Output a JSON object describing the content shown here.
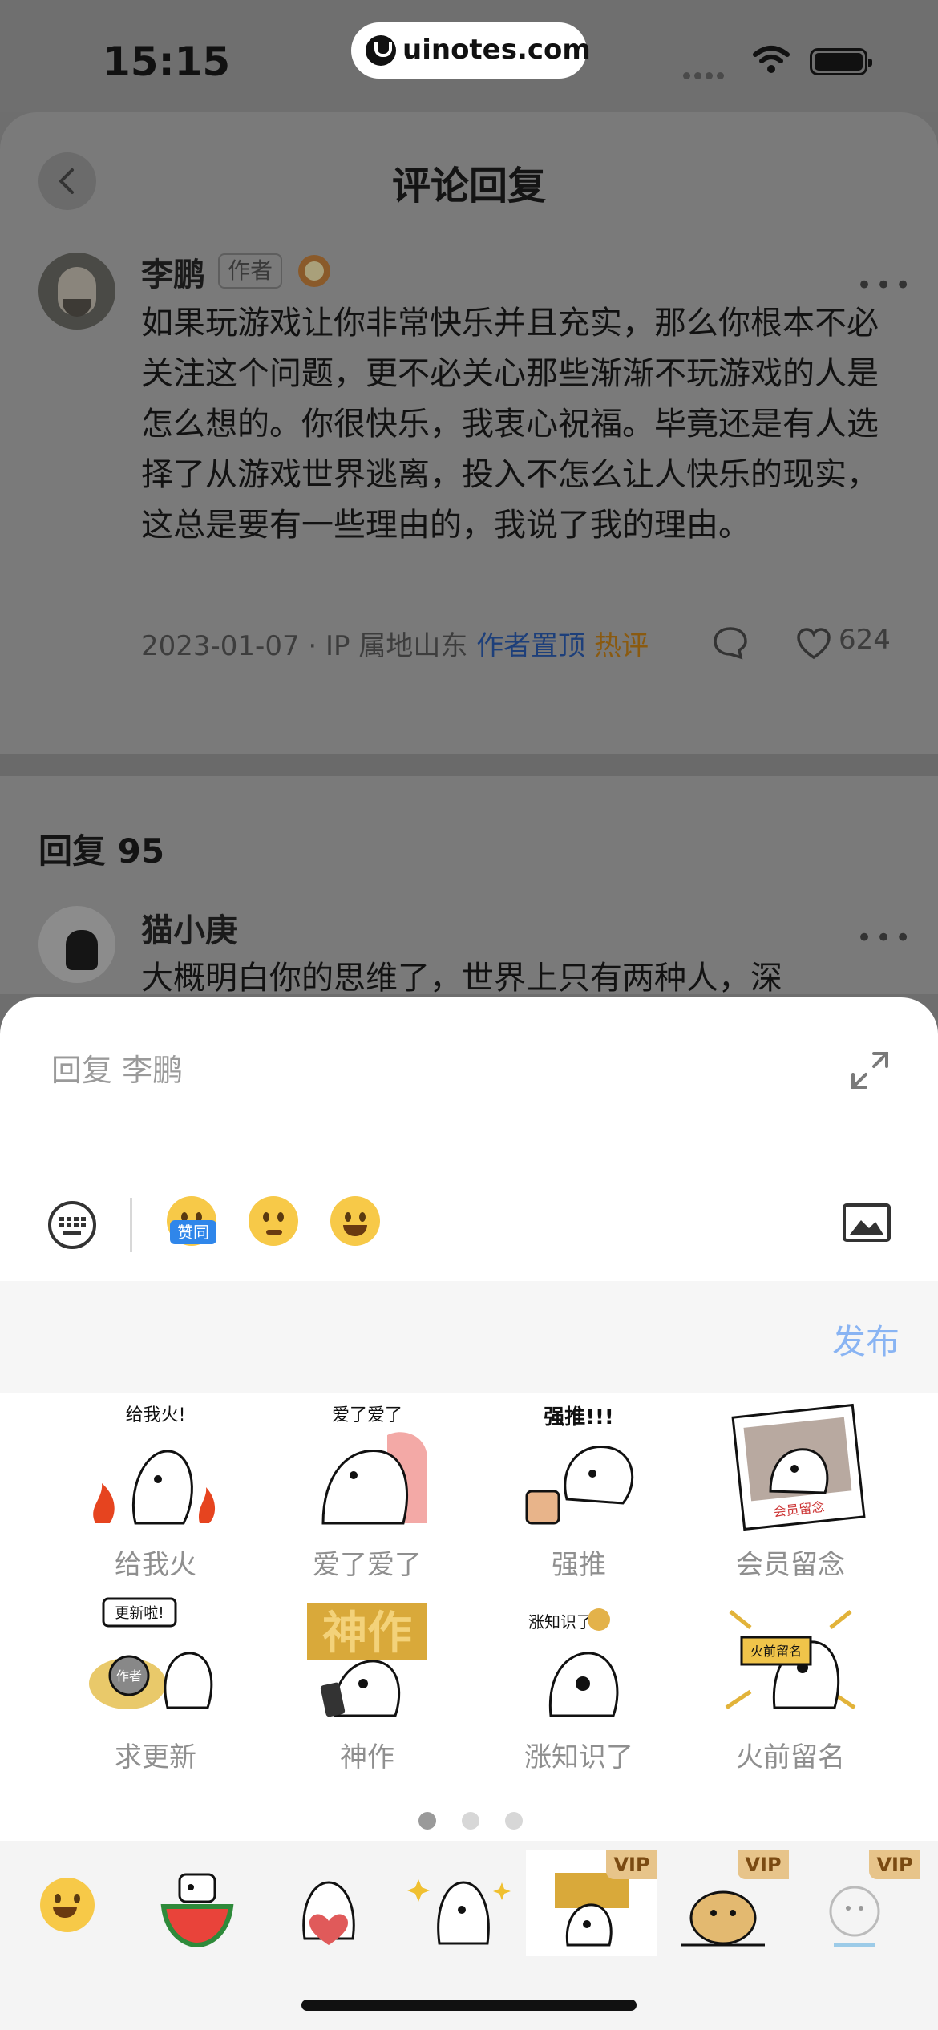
{
  "status_bar": {
    "time": "15:15",
    "url": "uinotes.com"
  },
  "header": {
    "title": "评论回复"
  },
  "main_comment": {
    "author": "李鹏",
    "author_tag": "作者",
    "text": "如果玩游戏让你非常快乐并且充实，那么你根本不必关注这个问题，更不必关心那些渐渐不玩游戏的人是怎么想的。你很快乐，我衷心祝福。毕竟还是有人选择了从游戏世界逃离，投入不怎么让人快乐的现实，这总是要有一些理由的，我说了我的理由。",
    "date": "2023-01-07",
    "location": "IP 属地山东",
    "pinned": "作者置顶",
    "hot": "热评",
    "likes": "624"
  },
  "replies": {
    "heading": "回复 95",
    "first": {
      "author": "猫小庚",
      "text": "大概明白你的思维了，世界上只有两种人，深"
    }
  },
  "reply_panel": {
    "placeholder": "回复 李鹏",
    "zan_tag": "赞同",
    "publish": "发布",
    "stickers": [
      {
        "label": "给我火",
        "caption": "给我火!"
      },
      {
        "label": "爱了爱了",
        "caption": "爱了爱了"
      },
      {
        "label": "强推",
        "caption": "强推!!!"
      },
      {
        "label": "会员留念",
        "caption": "会员留念"
      },
      {
        "label": "求更新",
        "caption": "更新啦!"
      },
      {
        "label": "神作",
        "caption": "神作"
      },
      {
        "label": "涨知识了",
        "caption": "涨知识了"
      },
      {
        "label": "火前留名",
        "caption": "火前留名"
      }
    ],
    "author_sign": "作者",
    "vip_label": "VIP",
    "page_count": 3,
    "active_page": 1
  },
  "icons": {
    "back": "chevron-left-icon",
    "more": "more-dots-icon",
    "reply": "comment-bubble-icon",
    "like": "heart-icon",
    "expand": "expand-arrows-icon",
    "keyboard": "keyboard-icon",
    "image": "image-icon"
  }
}
